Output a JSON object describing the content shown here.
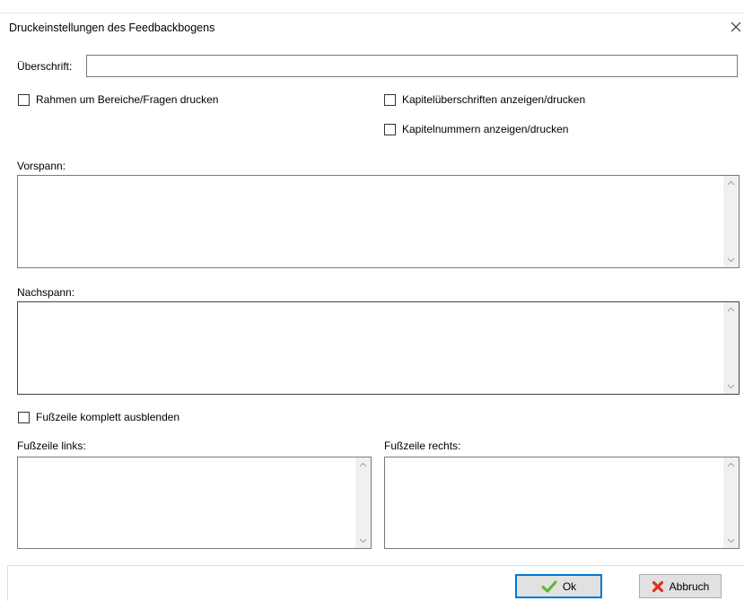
{
  "dialog": {
    "title": "Druckeinstellungen des Feedbackbogens"
  },
  "heading": {
    "label": "Überschrift:",
    "value": ""
  },
  "options": {
    "frame_label": "Rahmen um Bereiche/Fragen drucken",
    "frame_checked": false,
    "chapter_titles_label": "Kapitelüberschriften anzeigen/drucken",
    "chapter_titles_checked": false,
    "chapter_numbers_label": "Kapitelnummern anzeigen/drucken",
    "chapter_numbers_checked": false
  },
  "preamble": {
    "label": "Vorspann:",
    "value": ""
  },
  "epilogue": {
    "label": "Nachspann:",
    "value": ""
  },
  "footer": {
    "hide_label": "Fußzeile komplett ausblenden",
    "hide_checked": false,
    "left_label": "Fußzeile links:",
    "left_value": "",
    "right_label": "Fußzeile rechts:",
    "right_value": ""
  },
  "buttons": {
    "ok_label": "Ok",
    "cancel_label": "Abbruch"
  },
  "colors": {
    "ok_check": "#5cb82d",
    "cancel_x": "#e0301e",
    "default_border": "#0078d7"
  }
}
